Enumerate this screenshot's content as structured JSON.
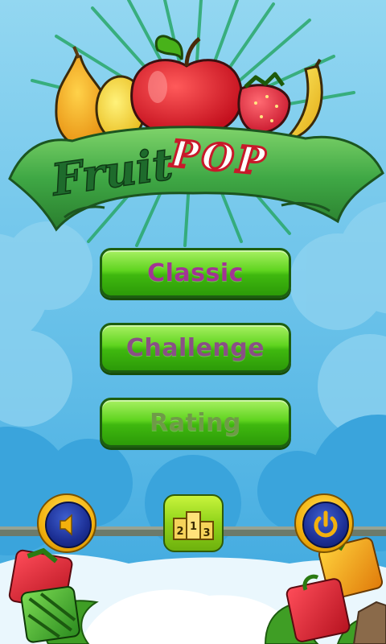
{
  "logo": {
    "word1": "Fruit",
    "word2": "POP"
  },
  "menu": {
    "classic_label": "Classic",
    "challenge_label": "Challenge",
    "rating_label": "Rating"
  },
  "podium": {
    "first": "1",
    "second": "2",
    "third": "3"
  },
  "icons": {
    "sound": "speaker-icon",
    "leaderboard": "podium-icon",
    "power": "power-icon"
  },
  "colors": {
    "classic_text": "#a23494",
    "challenge_text": "#8a4f86",
    "rating_text": "#6f9a48",
    "button_green": "#4cc615",
    "banner_green": "#2f9a3a",
    "pop_red": "#d8202e"
  }
}
